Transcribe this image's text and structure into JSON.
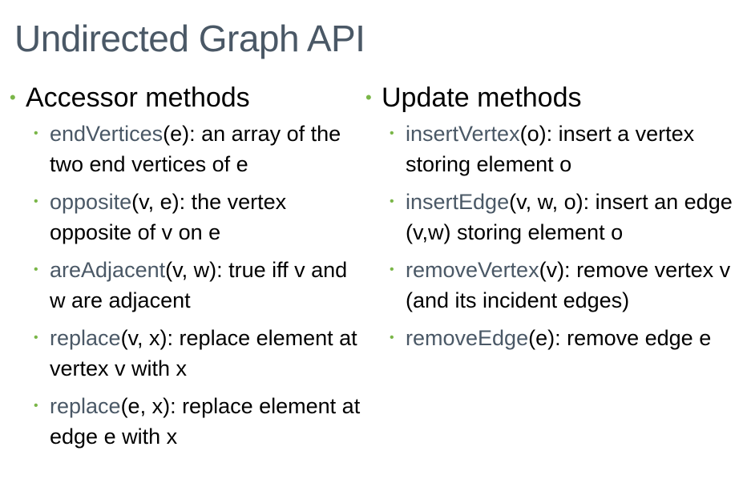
{
  "title": "Undirected Graph API",
  "accent_colors": {
    "title": "#4a5866",
    "bullet": "#7ab648",
    "method": "#4a5866"
  },
  "left": {
    "heading": "Accessor methods",
    "items": [
      {
        "method": "endVertices",
        "rest": "(e): an array of the two end vertices of e"
      },
      {
        "method": "opposite",
        "rest": "(v, e): the vertex opposite of v on e"
      },
      {
        "method": "areAdjacent",
        "rest": "(v, w): true iff v and w are adjacent"
      },
      {
        "method": "replace",
        "rest": "(v, x): replace element at vertex v with x"
      },
      {
        "method": "replace",
        "rest": "(e, x): replace element at edge e with x"
      }
    ]
  },
  "right": {
    "heading": "Update methods",
    "items": [
      {
        "method": "insertVertex",
        "rest": "(o): insert a vertex storing element o"
      },
      {
        "method": "insertEdge",
        "rest": "(v, w, o): insert an edge (v,w) storing element o"
      },
      {
        "method": "removeVertex",
        "rest": "(v): remove vertex v (and its incident edges)"
      },
      {
        "method": "removeEdge",
        "rest": "(e): remove edge e"
      }
    ]
  }
}
